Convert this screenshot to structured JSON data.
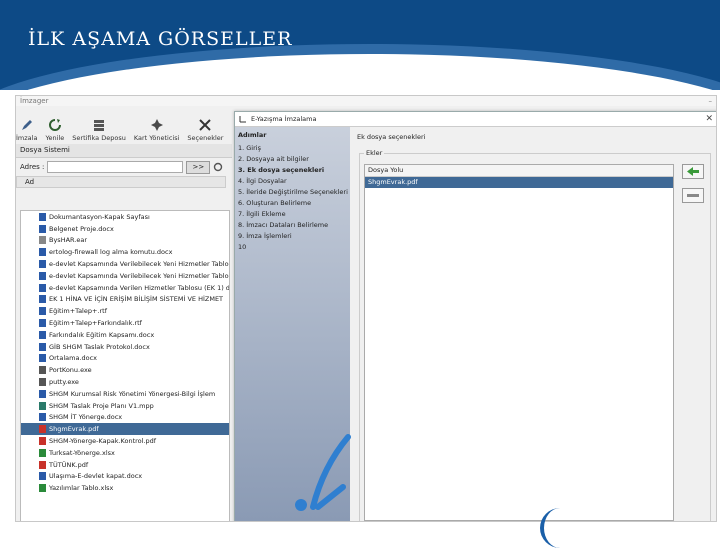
{
  "slide": {
    "title": "İLK AŞAMA GÖRSELLER"
  },
  "app": {
    "title": "İmzager",
    "toolbar": [
      {
        "label": "İmzala",
        "icon": "pen-icon"
      },
      {
        "label": "Yenile",
        "icon": "refresh-icon"
      },
      {
        "label": "Sertifika Deposu",
        "icon": "certificate-store-icon"
      },
      {
        "label": "Kart Yöneticisi",
        "icon": "card-manager-icon"
      },
      {
        "label": "Seçenekler",
        "icon": "options-icon"
      }
    ],
    "file_system_label": "Dosya Sistemi",
    "address_label": "Adres :",
    "address_value": "",
    "go_button": ">>",
    "column_header": "Ad",
    "files": [
      {
        "name": "Dokumantasyon-Kapak Sayfası",
        "type": "doc"
      },
      {
        "name": "Belgenet Proje.docx",
        "type": "doc"
      },
      {
        "name": "BysHAR.ear",
        "type": "file"
      },
      {
        "name": "ertolog-firewall log alma komutu.docx",
        "type": "doc"
      },
      {
        "name": "e-devlet Kapsamında Verilebilecek Yeni Hizmetler Tablo",
        "type": "doc"
      },
      {
        "name": "e-devlet Kapsamında Verilebilecek Yeni Hizmetler Tablo",
        "type": "doc"
      },
      {
        "name": "e-devlet Kapsamında Verilen Hizmetler Tablosu (EK 1) d",
        "type": "doc"
      },
      {
        "name": "EK 1 HİNA VE İÇİN ERİŞİM BİLİŞİM SİSTEMİ VE HİZMET",
        "type": "doc"
      },
      {
        "name": "Eğitim+Talep+.rtf",
        "type": "rtf"
      },
      {
        "name": "Eğitim+Talep+Farkındalık.rtf",
        "type": "rtf"
      },
      {
        "name": "Farkındalık Eğitim Kapsamı.docx",
        "type": "doc"
      },
      {
        "name": "GİB SHGM Taslak Protokol.docx",
        "type": "doc"
      },
      {
        "name": "Ortalama.docx",
        "type": "doc"
      },
      {
        "name": "PortKonu.exe",
        "type": "exe"
      },
      {
        "name": "putty.exe",
        "type": "exe"
      },
      {
        "name": "SHGM Kurumsal Risk Yönetimi Yönergesi-Bilgi İşlem",
        "type": "doc"
      },
      {
        "name": "SHGM Taslak Proje Planı V1.mpp",
        "type": "mpp"
      },
      {
        "name": "SHGM İT Yönerge.docx",
        "type": "doc"
      },
      {
        "name": "ShgmEvrak.pdf",
        "type": "pdf",
        "selected": true
      },
      {
        "name": "SHGM-Yönerge-Kapak.Kontrol.pdf",
        "type": "pdf"
      },
      {
        "name": "Turksat-Yönerge.xlsx",
        "type": "xls"
      },
      {
        "name": "TÜTÜNK.pdf",
        "type": "pdf"
      },
      {
        "name": "Ulaşıma-E-devlet kapat.docx",
        "type": "doc"
      },
      {
        "name": "Yazılımlar Tablo.xlsx",
        "type": "xls"
      }
    ]
  },
  "dialog": {
    "title": "E-Yazışma İmzalama",
    "steps_title": "Adımlar",
    "steps": [
      {
        "label": "1. Giriş"
      },
      {
        "label": "2. Dosyaya ait bilgiler"
      },
      {
        "label": "3. Ek dosya seçenekleri",
        "active": true
      },
      {
        "label": "4. İlgi Dosyalar"
      },
      {
        "label": "5. İleride Değiştirilme Seçenekleri"
      },
      {
        "label": "6. Oluşturan Belirleme"
      },
      {
        "label": "7. İlgili Ekleme"
      },
      {
        "label": "8. İmzacı Dataları Belirleme"
      },
      {
        "label": "9. İmza İşlemleri"
      },
      {
        "label": "10"
      }
    ],
    "panel_title": "Ek dosya seçenekleri",
    "group_label": "Ekler",
    "list_header": "Dosya Yolu",
    "attachments": [
      {
        "path": "ShgmEvrak.pdf",
        "selected": true
      }
    ],
    "add_button_icon": "add-icon",
    "remove_button_icon": "remove-icon"
  }
}
